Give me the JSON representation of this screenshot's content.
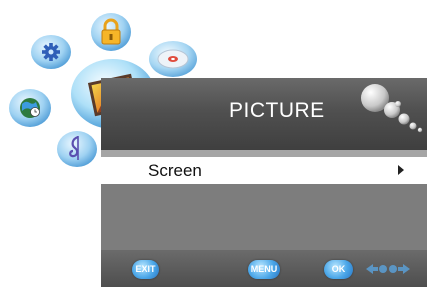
{
  "menu": {
    "title": "PICTURE",
    "items": [
      {
        "label": "Screen"
      }
    ]
  },
  "footer": {
    "exit_label": "EXIT",
    "menu_label": "MENU",
    "ok_label": "OK"
  },
  "icons": [
    "gear-icon",
    "lock-icon",
    "disc-icon",
    "picture-icon",
    "globe-icon",
    "music-note-icon"
  ],
  "colors": {
    "header": "#4f4f4f",
    "panel": "#a5a5a5",
    "selected_row": "#ffffff",
    "key_blue": "#4aa6e8"
  }
}
